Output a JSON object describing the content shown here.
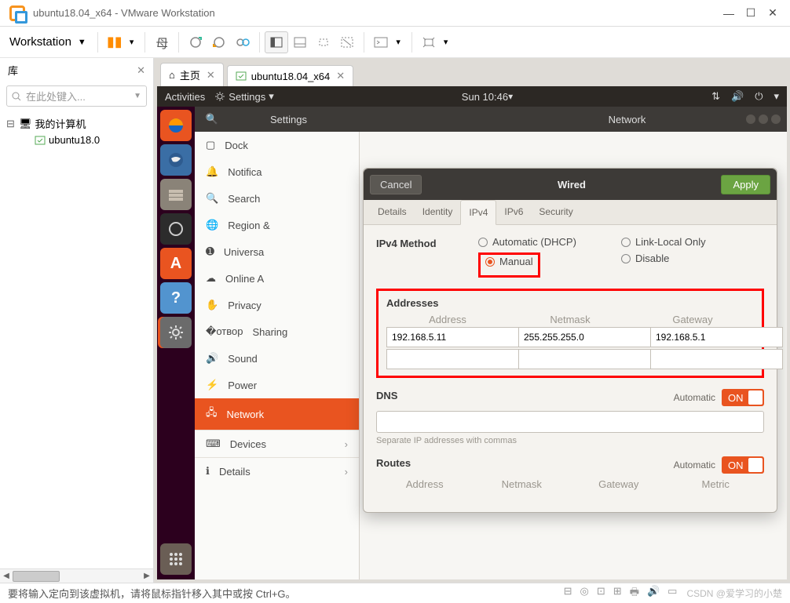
{
  "window": {
    "title": "ubuntu18.04_x64 - VMware Workstation"
  },
  "menu": {
    "workstation": "Workstation"
  },
  "library": {
    "title": "库",
    "search_placeholder": "在此处键入...",
    "root": "我的计算机",
    "vm": "ubuntu18.0"
  },
  "tabs": {
    "home": "主页",
    "vm": "ubuntu18.04_x64"
  },
  "gnomebar": {
    "activities": "Activities",
    "settings": "Settings",
    "clock": "Sun 10:46"
  },
  "settingswin": {
    "left": "Settings",
    "right": "Network"
  },
  "sidebar": {
    "dock": "Dock",
    "notif": "Notifica",
    "search": "Search",
    "region": "Region &",
    "universal": "Universa",
    "online": "Online A",
    "privacy": "Privacy",
    "sharing": "Sharing",
    "sound": "Sound",
    "power": "Power",
    "network": "Network",
    "devices": "Devices",
    "details": "Details"
  },
  "dialog": {
    "cancel": "Cancel",
    "title": "Wired",
    "apply": "Apply",
    "tabs": {
      "details": "Details",
      "identity": "Identity",
      "ipv4": "IPv4",
      "ipv6": "IPv6",
      "security": "Security"
    },
    "method_label": "IPv4 Method",
    "methods": {
      "auto": "Automatic (DHCP)",
      "link": "Link-Local Only",
      "manual": "Manual",
      "disable": "Disable"
    },
    "addresses": {
      "title": "Addresses",
      "col1": "Address",
      "col2": "Netmask",
      "col3": "Gateway",
      "r1c1": "192.168.5.11",
      "r1c2": "255.255.255.0",
      "r1c3": "192.168.5.1"
    },
    "dns": {
      "title": "DNS",
      "auto": "Automatic",
      "on": "ON",
      "hint": "Separate IP addresses with commas"
    },
    "routes": {
      "title": "Routes",
      "auto": "Automatic",
      "on": "ON",
      "c1": "Address",
      "c2": "Netmask",
      "c3": "Gateway",
      "c4": "Metric"
    }
  },
  "statusbar": {
    "msg": "要将输入定向到该虚拟机，请将鼠标指针移入其中或按 Ctrl+G。",
    "watermark": "CSDN @爱学习的小楚"
  }
}
